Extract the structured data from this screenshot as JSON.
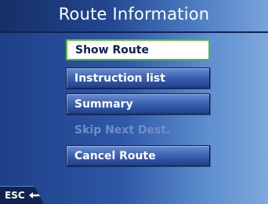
{
  "header": {
    "title": "Route Information"
  },
  "menu": {
    "items": [
      {
        "label": "Show Route"
      },
      {
        "label": "Instruction list"
      },
      {
        "label": "Summary"
      },
      {
        "label": "Skip Next Dest."
      },
      {
        "label": "Cancel Route"
      }
    ]
  },
  "footer": {
    "esc_label": "ESC"
  },
  "colors": {
    "selected_border": "#57b83a",
    "button_top": "#6b8fd3",
    "button_bottom": "#1f3f8a",
    "disabled_text": "#6f8fcb"
  }
}
